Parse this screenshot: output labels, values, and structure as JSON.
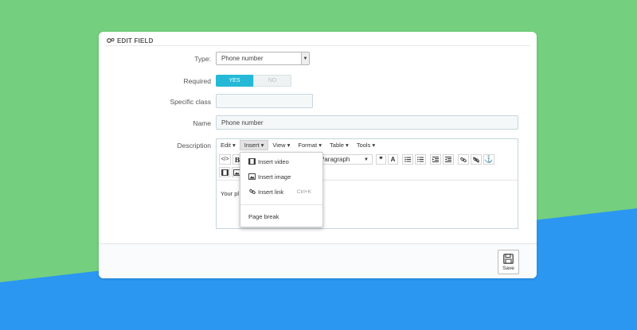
{
  "colors": {
    "bg_green": "#74cf7f",
    "bg_blue": "#2b97f1",
    "accent": "#25b9d7"
  },
  "panel": {
    "title": "EDIT FIELD",
    "title_icon": "gears-icon"
  },
  "form": {
    "type": {
      "label": "Type:",
      "value": "Phone number"
    },
    "required": {
      "label": "Required",
      "yes": "YES",
      "no": "NO",
      "selected": "YES"
    },
    "specific_class": {
      "label": "Specific class",
      "value": ""
    },
    "name": {
      "label": "Name",
      "value": "Phone number"
    },
    "description": {
      "label": "Description",
      "content_text": "Your pl"
    }
  },
  "editor": {
    "menubar": [
      "Edit",
      "Insert",
      "View",
      "Format",
      "Table",
      "Tools"
    ],
    "active_menu": "Insert",
    "paragraph_select": "Paragraph",
    "toolbar_icons": [
      "code-icon",
      "bold-icon",
      "blockquote-icon",
      "font-color-icon",
      "bullet-list-icon",
      "numbered-list-icon",
      "outdent-icon",
      "indent-icon",
      "link-icon",
      "unlink-icon",
      "anchor-icon",
      "video-icon",
      "image-icon"
    ],
    "bold_glyph": "B",
    "font_glyph": "A"
  },
  "insert_menu": {
    "items": [
      {
        "label": "Insert video",
        "icon": "video-icon"
      },
      {
        "label": "Insert image",
        "icon": "image-icon"
      },
      {
        "label": "Insert link",
        "icon": "link-icon",
        "shortcut": "Ctrl+K"
      },
      {
        "label": "Page break"
      }
    ]
  },
  "footer": {
    "save_label": "Save",
    "save_icon": "floppy-disk-icon"
  }
}
